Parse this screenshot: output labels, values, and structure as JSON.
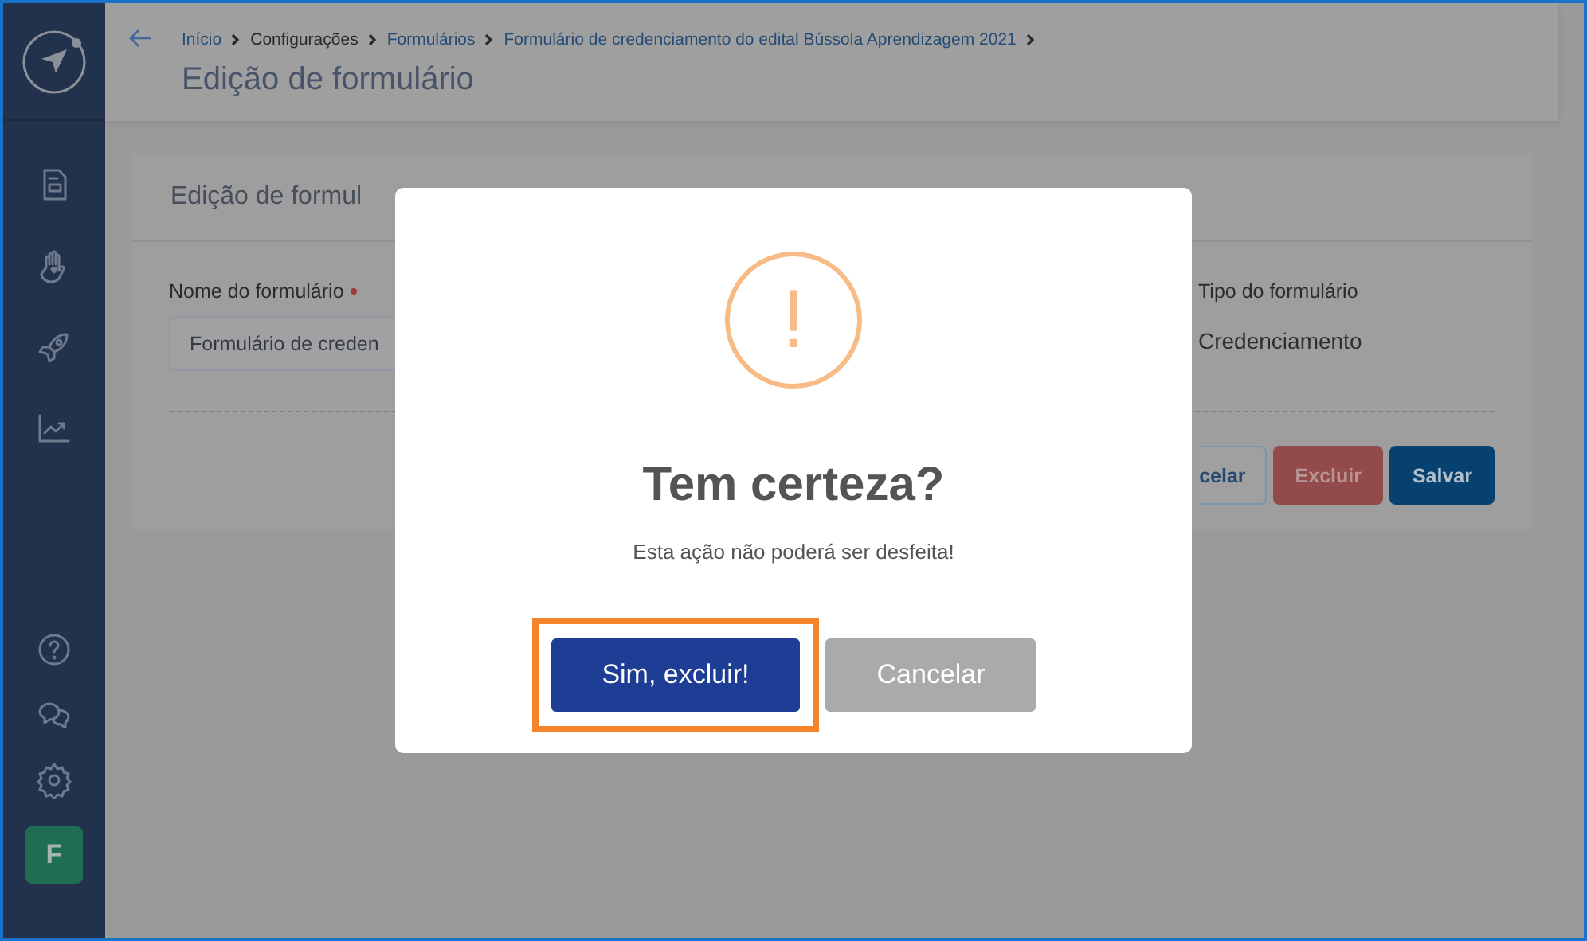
{
  "sidebar": {
    "avatar": "F"
  },
  "header": {
    "breadcrumb": [
      {
        "label": "Início",
        "kind": "link"
      },
      {
        "label": "Configurações",
        "kind": "current"
      },
      {
        "label": "Formulários",
        "kind": "link"
      },
      {
        "label": "Formulário de credenciamento do edital Bússola Aprendizagem 2021",
        "kind": "link"
      }
    ],
    "title": "Edição de formulário"
  },
  "card": {
    "title": "Edição de formul",
    "name_field": {
      "label": "Nome do formulário",
      "required": true,
      "value": "Formulário de creden"
    },
    "type_field": {
      "label": "Tipo do formulário",
      "value": "Credenciamento"
    },
    "buttons": [
      {
        "label": "celar",
        "kind": "outline"
      },
      {
        "label": "Excluir",
        "kind": "danger"
      },
      {
        "label": "Salvar",
        "kind": "primary"
      }
    ]
  },
  "dialog": {
    "icon": "!",
    "title": "Tem certeza?",
    "text": "Esta ação não poderá ser desfeita!",
    "buttons": [
      {
        "label": "Sim, excluir!",
        "kind": "confirm",
        "highlighted": true
      },
      {
        "label": "Cancelar",
        "kind": "cancel",
        "highlighted": false
      }
    ]
  }
}
